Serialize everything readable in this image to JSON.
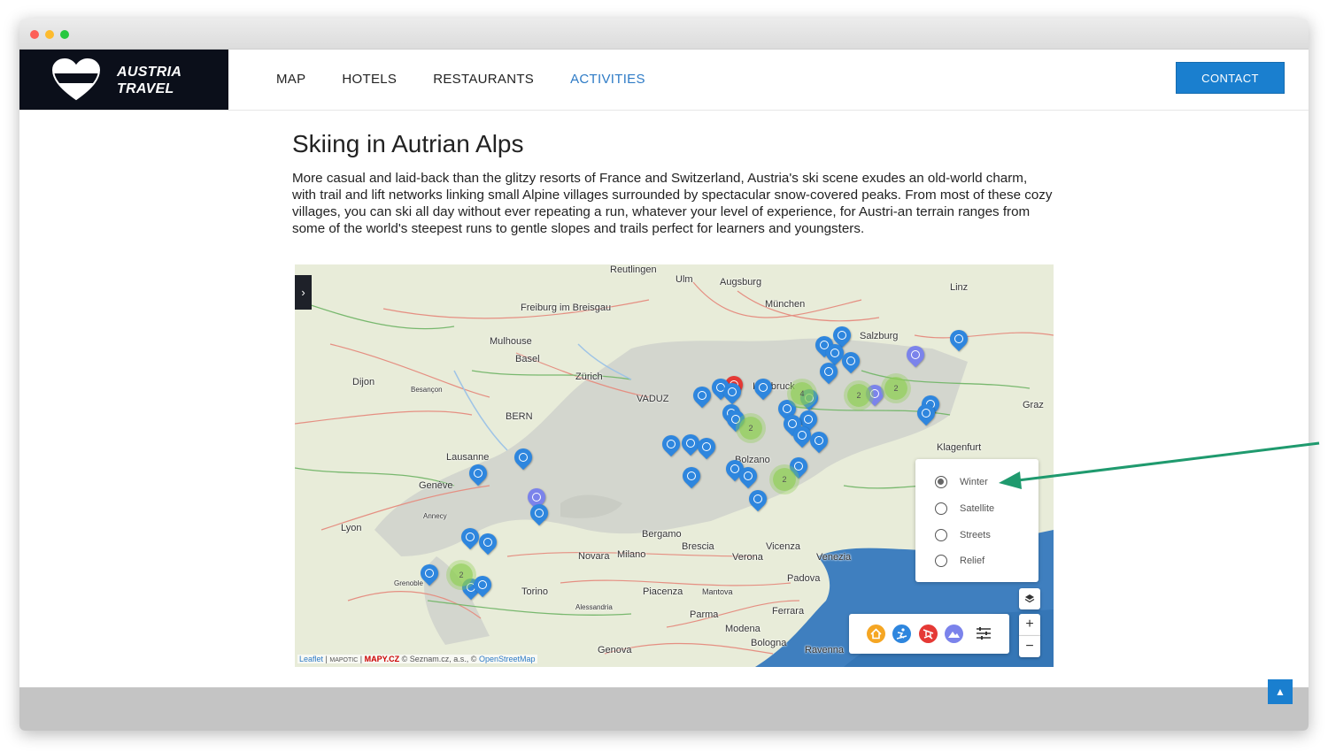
{
  "brand": {
    "line1": "AUSTRIA",
    "line2": "TRAVEL"
  },
  "nav": {
    "items": [
      {
        "label": "MAP"
      },
      {
        "label": "HOTELS"
      },
      {
        "label": "RESTAURANTS"
      },
      {
        "label": "ACTIVITIES",
        "active": true
      }
    ],
    "contact_label": "CONTACT"
  },
  "article": {
    "title": "Skiing in Autrian Alps",
    "body": "More casual and laid-back than the glitzy resorts of France and Switzerland, Austria's ski scene exudes an old-world charm, with trail and lift networks linking small Alpine villages surrounded by spectacular snow-covered peaks. From most of these cozy villages, you can ski all day without ever repeating a run, whatever your level of experience, for Austri-an terrain ranges from some of the world's steepest runs to gentle slopes and trails perfect for learners and youngsters."
  },
  "map": {
    "places": [
      "Reutlingen",
      "Ulm",
      "Augsburg",
      "München",
      "Linz",
      "Freiburg im Breisgau",
      "Mulhouse",
      "Basel",
      "Zürich",
      "Salzburg",
      "Dijon",
      "Innsbruck",
      "VADUZ",
      "BERN",
      "Besançon",
      "Graz",
      "Lausanne",
      "Klagenfurt",
      "Genève",
      "Bolzano",
      "Annecy",
      "Lyon",
      "Bergamo",
      "Brescia",
      "Vicenza",
      "Novara",
      "Milano",
      "Verona",
      "Venezia",
      "Grenoble",
      "Torino",
      "Padova",
      "Piacenza",
      "Mantova",
      "Parma",
      "Alessandria",
      "Ferrara",
      "Modena",
      "Bologna",
      "Genova",
      "Ravenna"
    ],
    "layers": [
      {
        "label": "Winter",
        "selected": true
      },
      {
        "label": "Satellite",
        "selected": false
      },
      {
        "label": "Streets",
        "selected": false
      },
      {
        "label": "Relief",
        "selected": false
      }
    ],
    "zoom_in": "+",
    "zoom_out": "−",
    "cluster_labels": [
      "4",
      "2",
      "2",
      "2",
      "2",
      "2"
    ],
    "attribution": {
      "leaflet": "Leaflet",
      "mapotic": "MAPOTIC",
      "mapy": "MAPY.CZ",
      "seznam": "© Seznam.cz, a.s., ©",
      "osm": "OpenStreetMap"
    },
    "category_colors": {
      "hotels": "#f5a623",
      "skiing": "#2e86de",
      "restaurants": "#e53935",
      "mountains": "#7b83eb"
    }
  },
  "colors": {
    "accent": "#1a7fcf",
    "active_nav": "#2e7bc6",
    "annotation_arrow": "#1f9a6e"
  }
}
